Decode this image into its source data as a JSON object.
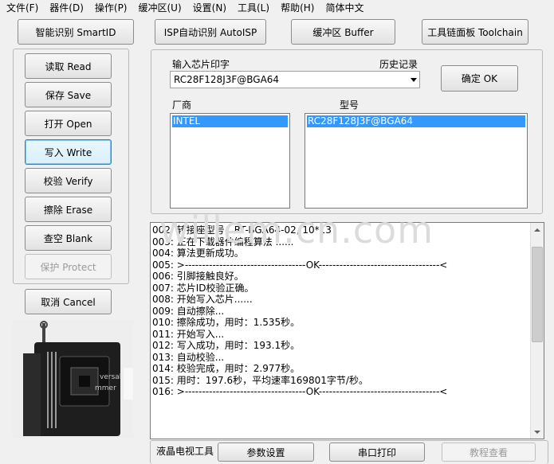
{
  "menu": [
    "文件(F)",
    "器件(D)",
    "操作(P)",
    "缓冲区(U)",
    "设置(N)",
    "工具(L)",
    "帮助(H)",
    "简体中文"
  ],
  "toolbar": {
    "smartid": "智能识别 SmartID",
    "isp": "ISP自动识别 AutoISP",
    "buffer": "缓冲区 Buffer",
    "toolchain": "工具链面板 Toolchain"
  },
  "ops": {
    "read": "读取 Read",
    "save": "保存 Save",
    "open": "打开 Open",
    "write": "写入 Write",
    "verify": "校验 Verify",
    "erase": "擦除 Erase",
    "blank": "查空 Blank",
    "protect": "保护 Protect",
    "cancel": "取消 Cancel"
  },
  "chip": {
    "input_label": "输入芯片印字",
    "history_label": "历史记录",
    "input_value": "RC28F128J3F@BGA64",
    "ok": "确定 OK",
    "vendor_label": "厂商",
    "model_label": "型号",
    "vendor_selected": "INTEL",
    "model_selected": "RC28F128J3F@BGA64"
  },
  "watermark": "willem.cn.com",
  "log": [
    "002: 转接座型号：RT-BGA64-02, 10*13",
    "003: 正在下载器件编程算法 ......",
    "004: 算法更新成功。",
    "005: >-----------------------------------OK-----------------------------------<",
    "006: 引脚接触良好。",
    "007: 芯片ID校验正确。",
    "008: 开始写入芯片......",
    "009: 自动擦除...",
    "010: 擦除成功，用时：1.535秒。",
    "011: 开始写入...",
    "012: 写入成功，用时：193.1秒。",
    "013: 自动校验...",
    "014: 校验完成，用时：2.977秒。",
    "015: 用时：197.6秒，平均速率169801字节/秒。",
    "016: >-----------------------------------OK-----------------------------------<"
  ],
  "bottom": {
    "lcd_label": "液晶电视工具",
    "params": "参数设置",
    "serial": "串口打印",
    "tutorial": "教程查看"
  }
}
